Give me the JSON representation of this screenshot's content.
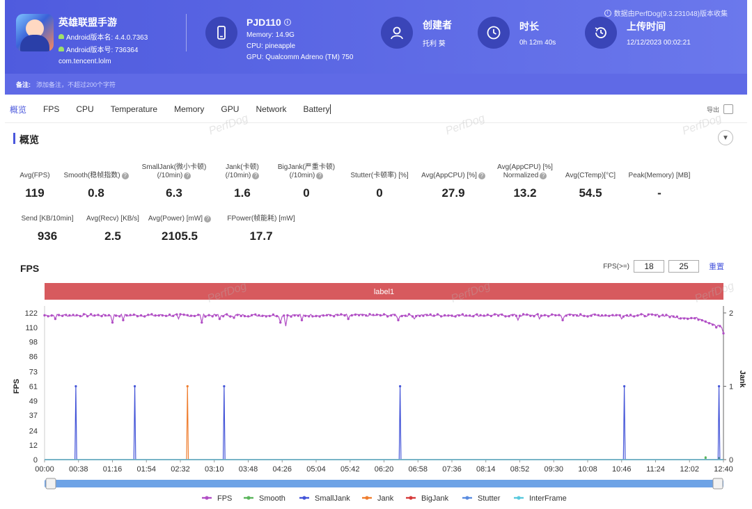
{
  "header": {
    "source_note": "数据由PerfDog(9.3.231048)版本收集",
    "app": {
      "name": "英雄联盟手游",
      "version_name": "Android版本名: 4.4.0.7363",
      "version_code": "Android版本号: 736364",
      "package": "com.tencent.lolm"
    },
    "device": {
      "name": "PJD110",
      "memory": "Memory: 14.9G",
      "cpu": "CPU: pineapple",
      "gpu": "GPU: Qualcomm Adreno (TM) 750"
    },
    "creator": {
      "title": "创建者",
      "value": "托利 葵"
    },
    "duration": {
      "title": "时长",
      "value": "0h 12m 40s"
    },
    "upload": {
      "title": "上传时间",
      "value": "12/12/2023 00:02:21"
    },
    "remark": {
      "label": "备注:",
      "placeholder": "添加备注，不超过200个字符"
    }
  },
  "tabs": [
    "概览",
    "FPS",
    "CPU",
    "Temperature",
    "Memory",
    "GPU",
    "Network",
    "Battery"
  ],
  "active_tab": "概览",
  "export_label": "导出",
  "watermark": "PerfDog",
  "overview": {
    "title": "概览",
    "row1": [
      {
        "label1": "",
        "label2": "Avg(FPS)",
        "help": false,
        "value": "119"
      },
      {
        "label1": "",
        "label2": "Smooth(稳帧指数)",
        "help": true,
        "value": "0.8"
      },
      {
        "label1": "SmallJank(微小卡顿)",
        "label2": "(/10min)",
        "help": true,
        "value": "6.3"
      },
      {
        "label1": "Jank(卡顿)",
        "label2": "(/10min)",
        "help": true,
        "value": "1.6"
      },
      {
        "label1": "BigJank(严重卡顿)",
        "label2": "(/10min)",
        "help": true,
        "value": "0"
      },
      {
        "label1": "",
        "label2": "Stutter(卡顿率) [%]",
        "help": false,
        "value": "0"
      },
      {
        "label1": "",
        "label2": "Avg(AppCPU) [%]",
        "help": true,
        "value": "27.9"
      },
      {
        "label1": "Avg(AppCPU) [%]",
        "label2": "Normalized",
        "help": true,
        "value": "13.2"
      },
      {
        "label1": "",
        "label2": "Avg(CTemp)[°C]",
        "help": false,
        "value": "54.5"
      },
      {
        "label1": "",
        "label2": "Peak(Memory) [MB]",
        "help": false,
        "value": "-"
      }
    ],
    "row2": [
      {
        "label1": "",
        "label2": "Send [KB/10min]",
        "help": false,
        "value": "936"
      },
      {
        "label1": "",
        "label2": "Avg(Recv) [KB/s]",
        "help": false,
        "value": "2.5"
      },
      {
        "label1": "",
        "label2": "Avg(Power) [mW]",
        "help": true,
        "value": "2105.5"
      },
      {
        "label1": "",
        "label2": "FPower(帧能耗) [mW]",
        "help": false,
        "value": "17.7"
      }
    ]
  },
  "fps_panel": {
    "title": "FPS",
    "threshold_label": "FPS(>=)",
    "threshold_1": "18",
    "threshold_2": "25",
    "reset_label": "重置"
  },
  "chart_data": {
    "type": "line",
    "band_label": "label1",
    "ylabel_left": "FPS",
    "ylabel_right": "Jank",
    "yticks_left": [
      "0",
      "12",
      "24",
      "37",
      "49",
      "61",
      "73",
      "86",
      "98",
      "110",
      "122"
    ],
    "yticks_right": [
      "0",
      "1",
      "2"
    ],
    "ylim_left": [
      0,
      122
    ],
    "ylim_right": [
      0,
      2
    ],
    "x_ticks": [
      "00:00",
      "00:38",
      "01:16",
      "01:54",
      "02:32",
      "03:10",
      "03:48",
      "04:26",
      "05:04",
      "05:42",
      "06:20",
      "06:58",
      "07:36",
      "08:14",
      "08:52",
      "09:30",
      "10:08",
      "10:46",
      "11:24",
      "12:02",
      "12:40"
    ],
    "x_range_seconds": [
      0,
      760
    ],
    "legend_placement": "bottom",
    "series": [
      {
        "name": "FPS",
        "axis": "left",
        "color": "#b14fc5",
        "baseline": 120,
        "noise": 1,
        "dips": [
          {
            "x": 12,
            "y": 117
          },
          {
            "x": 76,
            "y": 114
          },
          {
            "x": 88,
            "y": 116
          },
          {
            "x": 150,
            "y": 117
          },
          {
            "x": 177,
            "y": 114
          },
          {
            "x": 196,
            "y": 117
          },
          {
            "x": 213,
            "y": 118
          },
          {
            "x": 265,
            "y": 114
          },
          {
            "x": 270,
            "y": 111
          },
          {
            "x": 288,
            "y": 116
          },
          {
            "x": 340,
            "y": 117
          },
          {
            "x": 396,
            "y": 116
          },
          {
            "x": 414,
            "y": 117
          },
          {
            "x": 530,
            "y": 116
          },
          {
            "x": 555,
            "y": 117
          },
          {
            "x": 580,
            "y": 116
          },
          {
            "x": 646,
            "y": 117
          },
          {
            "x": 710,
            "y": 117
          },
          {
            "x": 742,
            "y": 114
          },
          {
            "x": 752,
            "y": 110
          },
          {
            "x": 756,
            "y": 111
          },
          {
            "x": 760,
            "y": 105
          }
        ],
        "end_drift": [
          {
            "x": 700,
            "y": 119
          },
          {
            "x": 720,
            "y": 118
          },
          {
            "x": 735,
            "y": 117
          },
          {
            "x": 748,
            "y": 113
          },
          {
            "x": 758,
            "y": 110
          }
        ]
      },
      {
        "name": "Smooth",
        "axis": "right",
        "color": "#5bb55c",
        "values_note": "near zero",
        "spikes": [
          {
            "x": 740,
            "y": 0.03
          },
          {
            "x": 755,
            "y": 0.02
          }
        ]
      },
      {
        "name": "SmallJank",
        "axis": "right",
        "color": "#4455d8",
        "spikes": [
          {
            "x": 35,
            "y": 1
          },
          {
            "x": 101,
            "y": 1
          },
          {
            "x": 201,
            "y": 1
          },
          {
            "x": 398,
            "y": 1
          },
          {
            "x": 649,
            "y": 1
          },
          {
            "x": 755,
            "y": 1
          }
        ]
      },
      {
        "name": "Jank",
        "axis": "right",
        "color": "#ef7d2e",
        "spikes": [
          {
            "x": 160,
            "y": 1
          }
        ]
      },
      {
        "name": "BigJank",
        "axis": "right",
        "color": "#d63b3b",
        "spikes": []
      },
      {
        "name": "Stutter",
        "axis": "right",
        "color": "#5a8ce0",
        "spikes": []
      },
      {
        "name": "InterFrame",
        "axis": "right",
        "color": "#59c9dd",
        "spikes": []
      }
    ]
  }
}
